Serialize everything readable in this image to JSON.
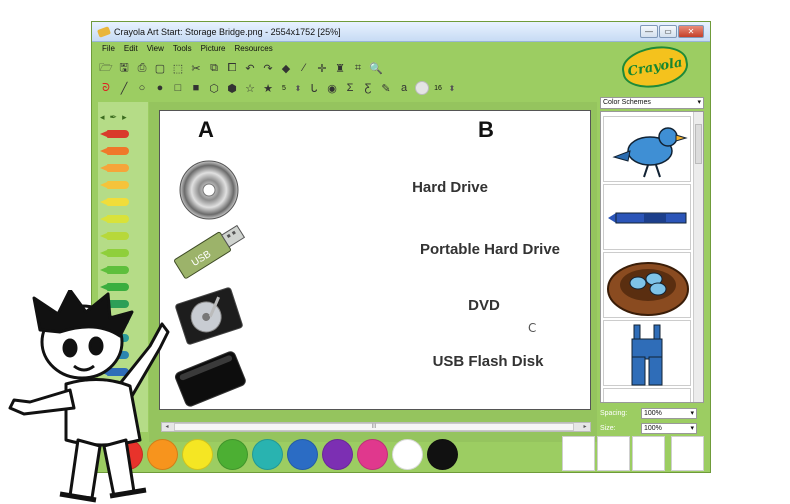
{
  "window": {
    "title": "Crayola Art Start: Storage Bridge.png - 2554x1752 [25%]",
    "minimize": "—",
    "maximize": "▭",
    "close": "✕"
  },
  "menu": [
    "File",
    "Edit",
    "View",
    "Tools",
    "Picture",
    "Resources"
  ],
  "toolbar": {
    "brush_size": "5",
    "stamp_size": "16"
  },
  "logo": {
    "text": "Crayola"
  },
  "canvas": {
    "col_a": "A",
    "col_b": "B",
    "labels": [
      "Hard Drive",
      "Portable Hard Drive",
      "DVD",
      "USB Flash Disk"
    ],
    "usb_text": "USB",
    "cursor": "℞"
  },
  "right_panel": {
    "scheme_select": "Color Schemes",
    "spacing_label": "Spacing:",
    "spacing_value": "100%",
    "size_label": "Size:",
    "size_value": "100%"
  },
  "scrollbar": {
    "grip": "III"
  },
  "palette_colors": [
    "#e8332b",
    "#f7941d",
    "#f5e623",
    "#4caf33",
    "#29b3b0",
    "#2b6cc4",
    "#7c2fb3",
    "#e0388d",
    "#ffffff",
    "#111111"
  ],
  "crayon_colors": [
    "#d93a2b",
    "#f0782a",
    "#f6a53a",
    "#f5c33b",
    "#f1dd3a",
    "#d9e23a",
    "#b7d83a",
    "#8fcf3b",
    "#5ebf3c",
    "#3aae3f",
    "#2d9f57",
    "#2b9e7a",
    "#2a9a9a",
    "#2b86b0",
    "#2f6db8",
    "#3b54b0",
    "#5a43a8"
  ]
}
